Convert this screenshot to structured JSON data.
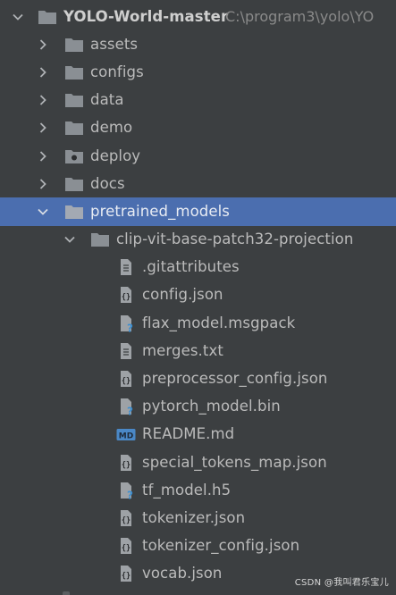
{
  "project": {
    "root_name": "YOLO-World-master",
    "root_path": "C:\\program3\\yolo\\YO"
  },
  "tree": {
    "items": [
      {
        "label": "assets",
        "kind": "folder"
      },
      {
        "label": "configs",
        "kind": "folder"
      },
      {
        "label": "data",
        "kind": "folder"
      },
      {
        "label": "demo",
        "kind": "folder"
      },
      {
        "label": "deploy",
        "kind": "folder-dot"
      },
      {
        "label": "docs",
        "kind": "folder"
      },
      {
        "label": "pretrained_models",
        "kind": "folder",
        "selected": true,
        "expanded": true
      },
      {
        "label": "clip-vit-base-patch32-projection",
        "kind": "folder",
        "expanded": true
      }
    ],
    "files": [
      {
        "label": ".gitattributes",
        "icon": "text-file-icon"
      },
      {
        "label": "config.json",
        "icon": "json-file-icon"
      },
      {
        "label": "flax_model.msgpack",
        "icon": "unknown-file-icon"
      },
      {
        "label": "merges.txt",
        "icon": "text-file-icon"
      },
      {
        "label": "preprocessor_config.json",
        "icon": "json-file-icon"
      },
      {
        "label": "pytorch_model.bin",
        "icon": "unknown-file-icon"
      },
      {
        "label": "README.md",
        "icon": "markdown-file-icon"
      },
      {
        "label": "special_tokens_map.json",
        "icon": "json-file-icon"
      },
      {
        "label": "tf_model.h5",
        "icon": "unknown-file-icon"
      },
      {
        "label": "tokenizer.json",
        "icon": "json-file-icon"
      },
      {
        "label": "tokenizer_config.json",
        "icon": "json-file-icon"
      },
      {
        "label": "vocab.json",
        "icon": "json-file-icon"
      }
    ]
  },
  "colors": {
    "background": "#3c3f41",
    "selection": "#4b6eaf",
    "folder": "#8a8f94",
    "text": "#bbbbbb",
    "unknown_badge": "#3d8fd1"
  },
  "watermark": "CSDN @我叫君乐宝儿"
}
